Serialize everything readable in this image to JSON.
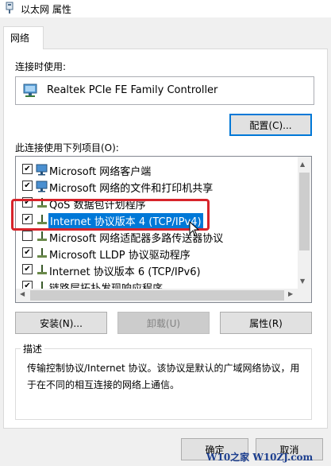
{
  "window": {
    "title": "以太网 属性"
  },
  "tabs": [
    {
      "label": "网络",
      "active": true
    }
  ],
  "connect_using": {
    "label": "连接时使用:",
    "adapter": "Realtek PCIe FE Family Controller",
    "configure_label": "配置(C)..."
  },
  "items": {
    "label": "此连接使用下列项目(O):",
    "list": [
      {
        "label": "Microsoft 网络客户端",
        "checked": true,
        "icon": "network-client-icon"
      },
      {
        "label": "Microsoft 网络的文件和打印机共享",
        "checked": true,
        "icon": "network-client-icon"
      },
      {
        "label": "QoS 数据包计划程序",
        "checked": true,
        "icon": "protocol-icon"
      },
      {
        "label": "Internet 协议版本 4 (TCP/IPv4)",
        "checked": true,
        "icon": "protocol-icon",
        "selected": true
      },
      {
        "label": "Microsoft 网络适配器多路传送器协议",
        "checked": false,
        "icon": "protocol-icon"
      },
      {
        "label": "Microsoft LLDP 协议驱动程序",
        "checked": true,
        "icon": "protocol-icon"
      },
      {
        "label": "Internet 协议版本 6 (TCP/IPv6)",
        "checked": true,
        "icon": "protocol-icon"
      },
      {
        "label": "链路层拓扑发现响应程序",
        "checked": true,
        "icon": "protocol-icon"
      }
    ]
  },
  "buttons": {
    "install": "安装(N)...",
    "uninstall": "卸载(U)",
    "properties": "属性(R)",
    "ok": "确定",
    "cancel": "取消"
  },
  "description": {
    "legend": "描述",
    "text": "传输控制协议/Internet 协议。该协议是默认的广域网络协议，用于在不同的相互连接的网络上通信。"
  },
  "watermark": "W10之家 W10ZJ.com",
  "colors": {
    "selection": "#0078d7",
    "highlight_box": "#d7242b",
    "focus_border": "#0078d7"
  }
}
